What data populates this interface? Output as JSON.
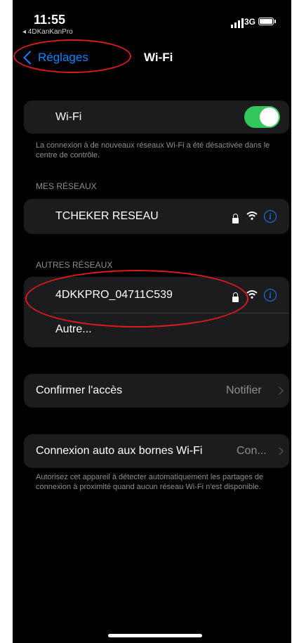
{
  "status_bar": {
    "time": "11:55",
    "back_app": "◂ 4DKanKanPro",
    "network": "3G"
  },
  "nav": {
    "back_label": "Réglages",
    "title": "Wi-Fi"
  },
  "wifi_toggle": {
    "label": "Wi-Fi",
    "on": true,
    "note": "La connexion à de nouveaux réseaux Wi-Fi a été désactivée dans le centre de contrôle."
  },
  "my_networks": {
    "header": "MES RÉSEAUX",
    "items": [
      {
        "name": "TCHEKER RESEAU",
        "secured": true
      }
    ]
  },
  "other_networks": {
    "header": "AUTRES RÉSEAUX",
    "items": [
      {
        "name": "4DKKPRO_04711C539",
        "secured": true
      }
    ],
    "other_label": "Autre..."
  },
  "ask_to_join": {
    "label": "Confirmer l'accès",
    "value": "Notifier"
  },
  "auto_join": {
    "label": "Connexion auto aux bornes Wi-Fi",
    "value": "Con...",
    "note": "Autorisez cet appareil à détecter automatiquement les partages de connexion à proximité quand aucun réseau Wi-Fi n'est disponible."
  },
  "icons": {
    "info_glyph": "i"
  },
  "colors": {
    "accent": "#0a84ff",
    "toggle_on": "#34c759",
    "annotation": "#e0191b",
    "background": "#000000",
    "cell": "#1c1c1e"
  }
}
